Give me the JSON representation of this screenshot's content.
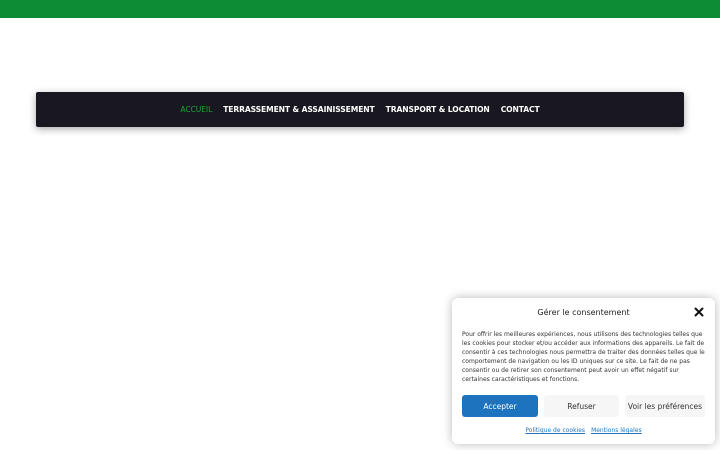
{
  "colors": {
    "top_bar": "#0e8c35",
    "nav_bg": "#191820",
    "nav_active": "#1aa33c",
    "button_primary": "#1e73be"
  },
  "nav": {
    "items": [
      {
        "label": "ACCUEIL",
        "active": true
      },
      {
        "label": "TERRASSEMENT & ASSAINISSEMENT",
        "active": false
      },
      {
        "label": "TRANSPORT & LOCATION",
        "active": false
      },
      {
        "label": "CONTACT",
        "active": false
      }
    ]
  },
  "consent": {
    "title": "Gérer le consentement",
    "close_icon": "close-icon",
    "text": "Pour offrir les meilleures expériences, nous utilisons des technologies telles que les cookies pour stocker et/ou accéder aux informations des appareils. Le fait de consentir à ces technologies nous permettra de traiter des données telles que le comportement de navigation ou les ID uniques sur ce site. Le fait de ne pas consentir ou de retirer son consentement peut avoir un effet négatif sur certaines caractéristiques et fonctions.",
    "accept_label": "Accepter",
    "refuse_label": "Refuser",
    "preferences_label": "Voir les préférences",
    "policy_link": "Politique de cookies",
    "legal_link": "Mentions légales"
  }
}
